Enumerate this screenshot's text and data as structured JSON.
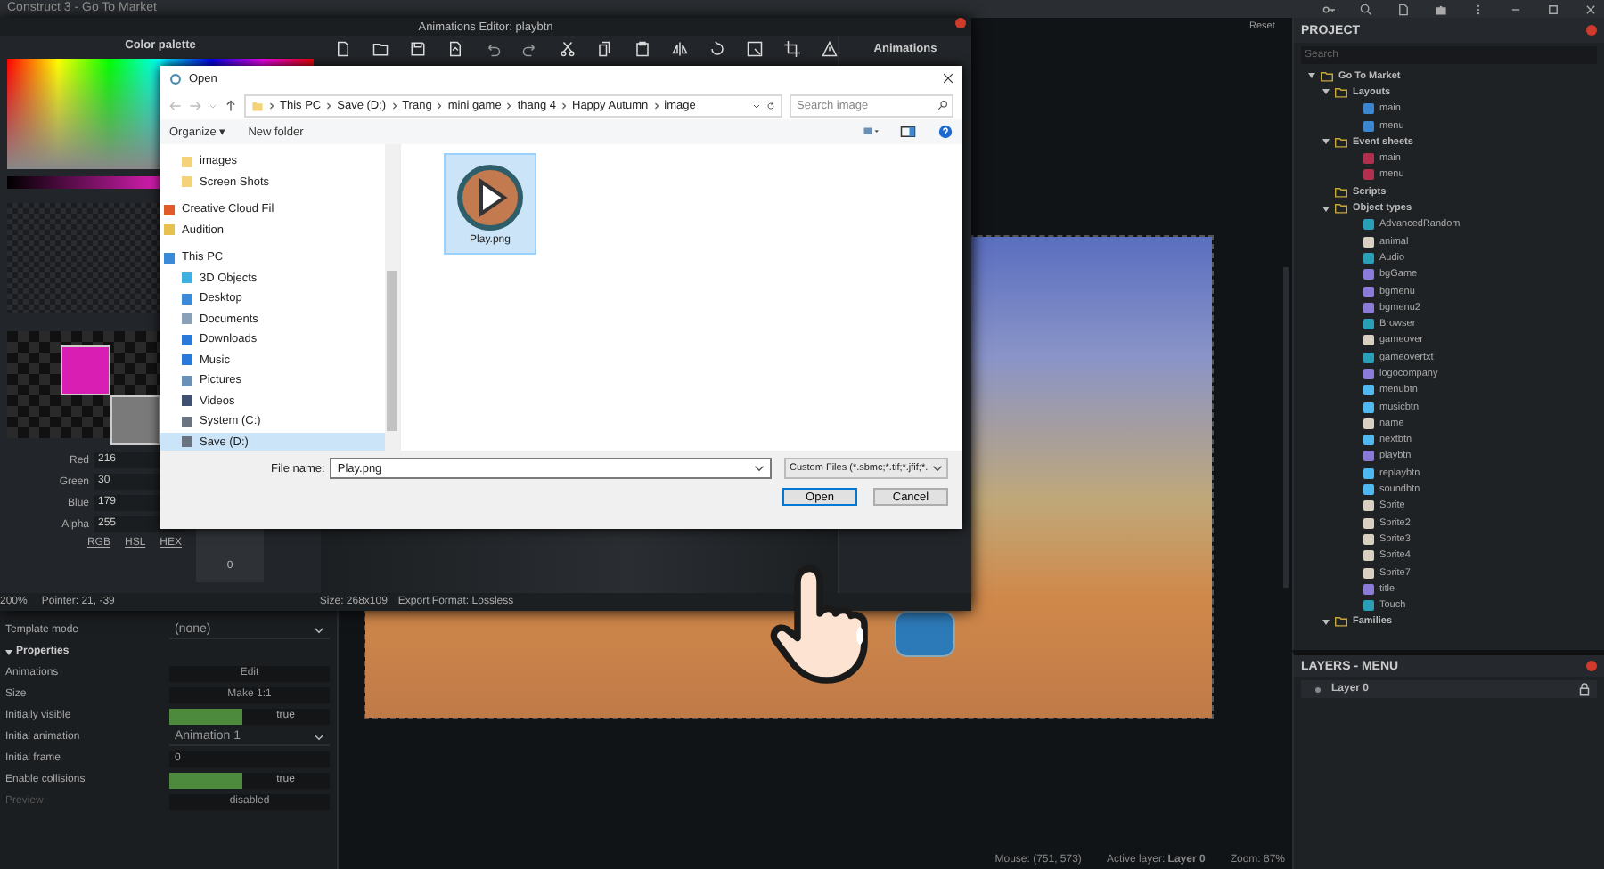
{
  "app": {
    "title": "Construct 3 - Go To Market"
  },
  "animations_editor": {
    "title": "Animations Editor: playbtn",
    "palette_title": "Color palette",
    "hue_slider": {
      "level": 0.9
    },
    "channels": [
      {
        "label": "Red",
        "value": "216"
      },
      {
        "label": "Green",
        "value": "30"
      },
      {
        "label": "Blue",
        "value": "179"
      },
      {
        "label": "Alpha",
        "value": "255"
      }
    ],
    "modes": [
      "RGB",
      "HSL",
      "HEX"
    ],
    "frame_number": "0",
    "animations_title": "Animations",
    "reset": "Reset",
    "status": {
      "zoom": "200%",
      "pointer": "Pointer: 21, -39",
      "size": "Size: 268x109",
      "export": "Export Format: Lossless"
    }
  },
  "open_dialog": {
    "title": "Open",
    "path": [
      "This PC",
      "Save (D:)",
      "Trang",
      "mini game",
      "thang 4",
      "Happy Autumn",
      "image"
    ],
    "search": {
      "placeholder": "Search image"
    },
    "organize": "Organize ▾",
    "new_folder": "New folder",
    "sidebar": [
      {
        "label": "images",
        "kind": "folder",
        "selected": false
      },
      {
        "label": "Screen Shots",
        "kind": "folder",
        "selected": false
      },
      {
        "label": "Creative Cloud Fil",
        "kind": "cloud",
        "selected": false
      },
      {
        "label": "Audition",
        "kind": "sync",
        "selected": false
      },
      {
        "label": "This PC",
        "kind": "pc",
        "selected": false
      },
      {
        "label": "3D Objects",
        "kind": "objects",
        "selected": false
      },
      {
        "label": "Desktop",
        "kind": "desktop",
        "selected": false
      },
      {
        "label": "Documents",
        "kind": "documents",
        "selected": false
      },
      {
        "label": "Downloads",
        "kind": "downloads",
        "selected": false
      },
      {
        "label": "Music",
        "kind": "music",
        "selected": false
      },
      {
        "label": "Pictures",
        "kind": "pictures",
        "selected": false
      },
      {
        "label": "Videos",
        "kind": "videos",
        "selected": false
      },
      {
        "label": "System (C:)",
        "kind": "drive",
        "selected": false
      },
      {
        "label": "Save (D:)",
        "kind": "drive",
        "selected": true
      }
    ],
    "files": [
      {
        "name": "Play.png",
        "selected": true
      }
    ],
    "file_name_label": "File name:",
    "file_name": "Play.png",
    "file_type": "Custom Files (*.sbmc;*.tif;*.jfif;*.",
    "buttons": [
      "Open",
      "Cancel"
    ]
  },
  "properties": [
    {
      "label": "Template mode",
      "kind": "dropdown",
      "value": "(none)"
    },
    {
      "label": "Properties",
      "kind": "header",
      "expanded": true
    },
    {
      "label": "Animations",
      "kind": "button",
      "value": "Edit"
    },
    {
      "label": "Size",
      "kind": "button",
      "value": "Make 1:1"
    },
    {
      "label": "Initially visible",
      "kind": "toggle",
      "checked": true,
      "value": "true"
    },
    {
      "label": "Initial animation",
      "kind": "dropdown",
      "value": "Animation 1"
    },
    {
      "label": "Initial frame",
      "kind": "value",
      "value": "0"
    },
    {
      "label": "Enable collisions",
      "kind": "toggle",
      "checked": true,
      "value": "true"
    },
    {
      "label": "Preview",
      "kind": "disabled",
      "value": "disabled"
    }
  ],
  "project": {
    "title": "PROJECT",
    "search": {
      "placeholder": "Search"
    },
    "tree": [
      {
        "label": "Go To Market",
        "kind": "folder",
        "expanded": true,
        "children": [
          {
            "label": "Layouts",
            "kind": "folder",
            "expanded": true,
            "children": [
              {
                "label": "main",
                "kind": "layout"
              },
              {
                "label": "menu",
                "kind": "layout"
              }
            ]
          },
          {
            "label": "Event sheets",
            "kind": "folder",
            "expanded": true,
            "children": [
              {
                "label": "main",
                "kind": "events"
              },
              {
                "label": "menu",
                "kind": "events"
              }
            ]
          },
          {
            "label": "Scripts",
            "kind": "folder"
          },
          {
            "label": "Object types",
            "kind": "folder",
            "expanded": true,
            "children": [
              {
                "label": "AdvancedRandom",
                "kind": "plugin"
              },
              {
                "label": "animal",
                "kind": "sprite"
              },
              {
                "label": "Audio",
                "kind": "audio"
              },
              {
                "label": "bgGame",
                "kind": "image"
              },
              {
                "label": "bgmenu",
                "kind": "image"
              },
              {
                "label": "bgmenu2",
                "kind": "image"
              },
              {
                "label": "Browser",
                "kind": "globe"
              },
              {
                "label": "gameover",
                "kind": "sprite"
              },
              {
                "label": "gameovertxt",
                "kind": "text"
              },
              {
                "label": "logocompany",
                "kind": "image"
              },
              {
                "label": "menubtn",
                "kind": "round"
              },
              {
                "label": "musicbtn",
                "kind": "round"
              },
              {
                "label": "name",
                "kind": "sprite"
              },
              {
                "label": "nextbtn",
                "kind": "round"
              },
              {
                "label": "playbtn",
                "kind": "image"
              },
              {
                "label": "replaybtn",
                "kind": "round"
              },
              {
                "label": "soundbtn",
                "kind": "round"
              },
              {
                "label": "Sprite",
                "kind": "sprite"
              },
              {
                "label": "Sprite2",
                "kind": "sprite"
              },
              {
                "label": "Sprite3",
                "kind": "sprite"
              },
              {
                "label": "Sprite4",
                "kind": "sprite"
              },
              {
                "label": "Sprite7",
                "kind": "sprite"
              },
              {
                "label": "title",
                "kind": "image"
              },
              {
                "label": "Touch",
                "kind": "touch"
              }
            ]
          },
          {
            "label": "Families",
            "kind": "folder",
            "expanded": true
          }
        ]
      }
    ]
  },
  "layers": {
    "title": "LAYERS - MENU",
    "items": [
      {
        "label": "Layer 0",
        "locked": true
      }
    ]
  },
  "status_bar": {
    "mouse": "Mouse: (751, 573)",
    "layer": "Active layer: **Layer 0**",
    "zoom": "Zoom: 87%"
  }
}
